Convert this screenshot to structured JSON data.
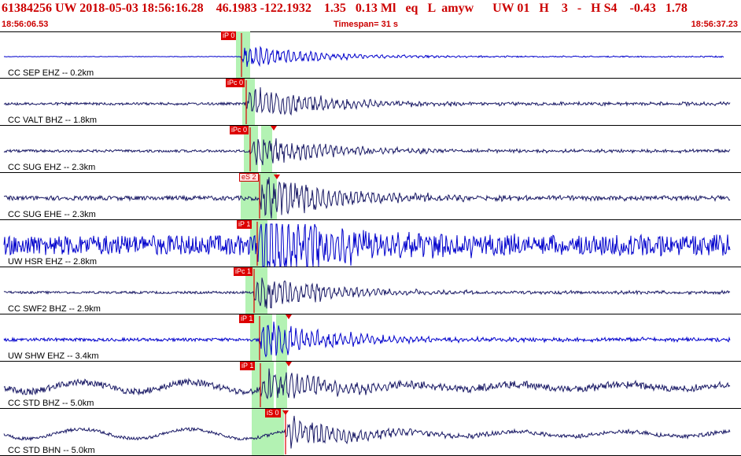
{
  "header": {
    "event_line": "61384256 UW 2018-05-03 18:56:16.28    46.1983 -122.1932    1.35   0.13 Ml   eq   L  amyw      UW 01   H    3   -   H S4    -0.43   1.78",
    "start_time": "18:56:06.53",
    "timespan": "Timespan=  31 s",
    "end_time": "18:56:37.23"
  },
  "colors": {
    "header_text": "#cc0000",
    "trace_blue": "#0000cc",
    "trace_navy": "#1a1a66",
    "pick": "#dd0000",
    "window": "#b3f2b3"
  },
  "traces": [
    {
      "label": "CC SEP EHZ -- 0.2km",
      "pick": "iP 0",
      "color": "blue"
    },
    {
      "label": "CC VALT BHZ -- 1.8km",
      "pick": "iPc 0",
      "color": "navy"
    },
    {
      "label": "CC SUG EHZ -- 2.3km",
      "pick": "iPc 0",
      "color": "navy"
    },
    {
      "label": "CC SUG EHE -- 2.3km",
      "pick": "eS 2",
      "color": "navy"
    },
    {
      "label": "UW HSR EHZ -- 2.8km",
      "pick": "iP 1",
      "color": "blue"
    },
    {
      "label": "CC SWF2 BHZ -- 2.9km",
      "pick": "iPc 1",
      "color": "navy"
    },
    {
      "label": "UW SHW EHZ -- 3.4km",
      "pick": "iP 1",
      "color": "blue"
    },
    {
      "label": "CC STD BHZ -- 5.0km",
      "pick": "iP 1",
      "color": "navy"
    },
    {
      "label": "CC STD BHN -- 5.0km",
      "pick": "iS 0",
      "color": "navy"
    }
  ]
}
